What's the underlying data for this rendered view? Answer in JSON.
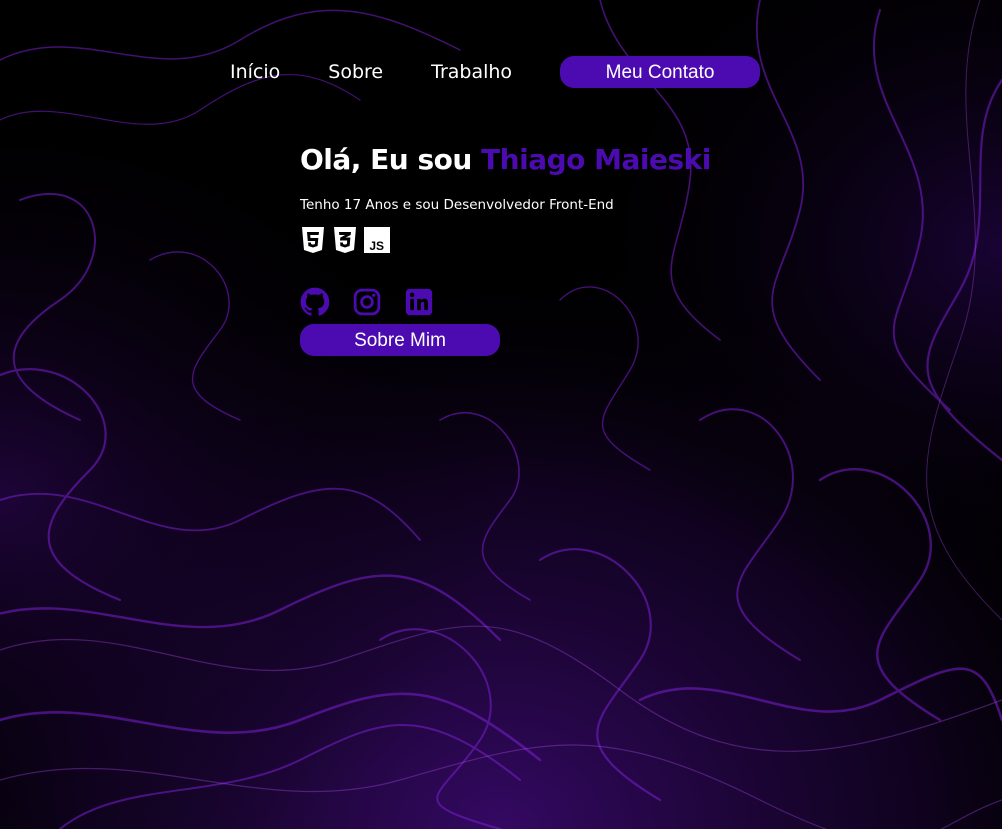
{
  "nav": {
    "items": [
      {
        "label": "Início"
      },
      {
        "label": "Sobre"
      },
      {
        "label": "Trabalho"
      }
    ],
    "contact_label": "Meu Contato"
  },
  "hero": {
    "greeting": "Olá, Eu sou ",
    "name": "Thiago Maieski",
    "subtitle": "Tenho 17 Anos e sou Desenvolvedor Front-End",
    "tech_icons": [
      "html5-icon",
      "css3-icon",
      "javascript-icon"
    ],
    "tech_js_text": "JS",
    "social_icons": [
      "github-icon",
      "instagram-icon",
      "linkedin-icon"
    ],
    "about_label": "Sobre Mim"
  },
  "colors": {
    "accent": "#4c0bb0",
    "background": "#000000",
    "text": "#ffffff",
    "swirl": "#7a1fd0"
  }
}
